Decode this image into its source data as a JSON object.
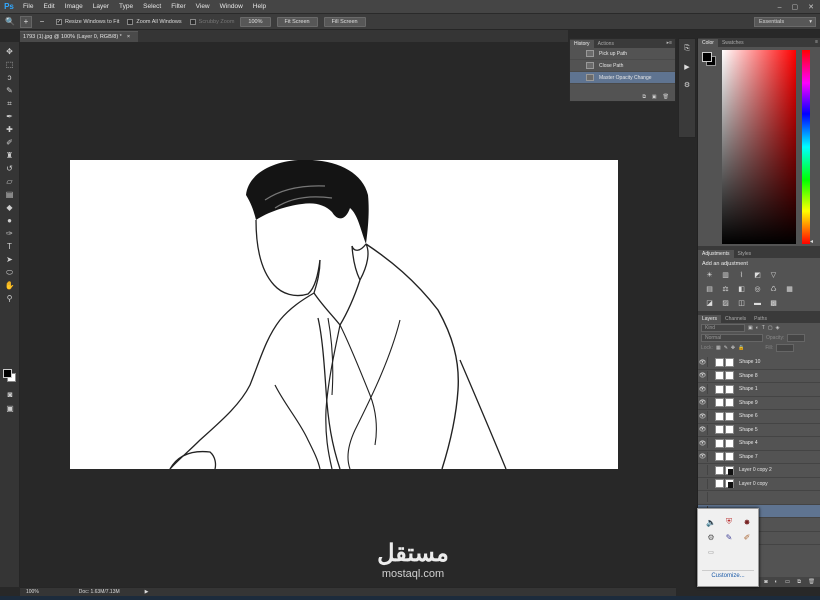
{
  "app": {
    "logo": "Ps"
  },
  "menu": [
    "File",
    "Edit",
    "Image",
    "Layer",
    "Type",
    "Select",
    "Filter",
    "View",
    "Window",
    "Help"
  ],
  "window_controls": [
    "–",
    "▢",
    "✕"
  ],
  "options": {
    "resize_windows": "Resize Windows to Fit",
    "zoom_all": "Zoom All Windows",
    "scrubby": "Scrubby Zoom",
    "btn_100": "100%",
    "btn_fit": "Fit Screen",
    "btn_fill": "Fill Screen",
    "workspace": "Essentials"
  },
  "document_tab": {
    "title": "1793 (1).jpg @ 100% (Layer 0, RGB/8) *",
    "close": "×"
  },
  "history": {
    "tabs": [
      "History",
      "Actions"
    ],
    "items": [
      "Pick up Path",
      "Close Path",
      "Master Opacity Change"
    ],
    "selected_index": 2
  },
  "color": {
    "tabs": [
      "Color",
      "Swatches"
    ],
    "fg": "#000000",
    "bg": "#000000"
  },
  "adjustments": {
    "tabs": [
      "Adjustments",
      "Styles"
    ],
    "title": "Add an adjustment"
  },
  "layers": {
    "tabs": [
      "Layers",
      "Channels",
      "Paths"
    ],
    "filter": "Kind",
    "blend_mode": "Normal",
    "opacity_label": "Opacity:",
    "lock_label": "Lock:",
    "fill_label": "Fill:",
    "rows": [
      {
        "name": "Shape 10",
        "dark": false
      },
      {
        "name": "Shape 8",
        "dark": false
      },
      {
        "name": "Shape 1",
        "dark": false
      },
      {
        "name": "Shape 9",
        "dark": false
      },
      {
        "name": "Shape 6",
        "dark": false
      },
      {
        "name": "Shape 5",
        "dark": false
      },
      {
        "name": "Shape 4",
        "dark": false
      },
      {
        "name": "Shape 7",
        "dark": false
      },
      {
        "name": "Layer 0 copy 2",
        "dark": true
      },
      {
        "name": "Layer 0 copy",
        "dark": true
      }
    ]
  },
  "status": {
    "zoom": "100%",
    "doc": "Doc: 1.63M/7.13M"
  },
  "tray": {
    "customize": "Customize..."
  },
  "watermark": {
    "arabic": "مستقل",
    "latin": "mostaql.com"
  }
}
